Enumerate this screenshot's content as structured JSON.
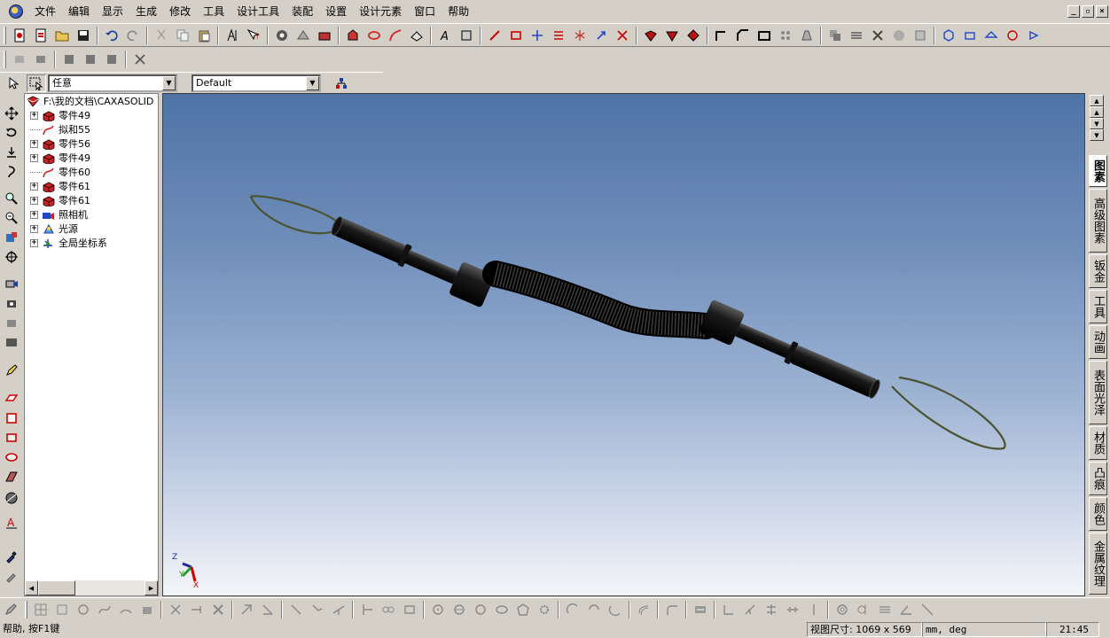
{
  "menu": [
    "文件",
    "编辑",
    "显示",
    "生成",
    "修改",
    "工具",
    "设计工具",
    "装配",
    "设置",
    "设计元素",
    "窗口",
    "帮助"
  ],
  "window_buttons": [
    "_",
    "▫",
    "×"
  ],
  "select_bar": {
    "filter_value": "任意",
    "config_value": "Default"
  },
  "tree": {
    "root": "F:\\我的文档\\CAXASOLID",
    "items": [
      {
        "label": "零件49",
        "expandable": true,
        "icon": "part-icon"
      },
      {
        "label": "拟和55",
        "expandable": false,
        "icon": "curve-icon"
      },
      {
        "label": "零件56",
        "expandable": true,
        "icon": "part-icon"
      },
      {
        "label": "零件49",
        "expandable": true,
        "icon": "part-icon"
      },
      {
        "label": "零件60",
        "expandable": false,
        "icon": "curve-icon"
      },
      {
        "label": "零件61",
        "expandable": true,
        "icon": "part-icon"
      },
      {
        "label": "零件61",
        "expandable": true,
        "icon": "part-icon"
      },
      {
        "label": "照相机",
        "expandable": true,
        "icon": "camera-icon"
      },
      {
        "label": "光源",
        "expandable": true,
        "icon": "light-icon"
      },
      {
        "label": "全局坐标系",
        "expandable": true,
        "icon": "axis-icon"
      }
    ]
  },
  "axis_triad": {
    "x": "X",
    "y": "Y",
    "z": "Z"
  },
  "right_tabs": [
    "图素",
    "高级图素",
    "钣金",
    "工具",
    "动画",
    "表面光泽",
    "材质",
    "凸痕",
    "颜色",
    "金属纹理"
  ],
  "status": {
    "help": "帮助, 按F1键",
    "view_size": "视图尺寸: 1069 x  569",
    "units": "mm, deg",
    "time": "21:45"
  },
  "colors": {
    "background_top": "#4f73a6",
    "background_bottom": "#f4f5f8",
    "model": "#111111",
    "cable": "#4b5330"
  }
}
